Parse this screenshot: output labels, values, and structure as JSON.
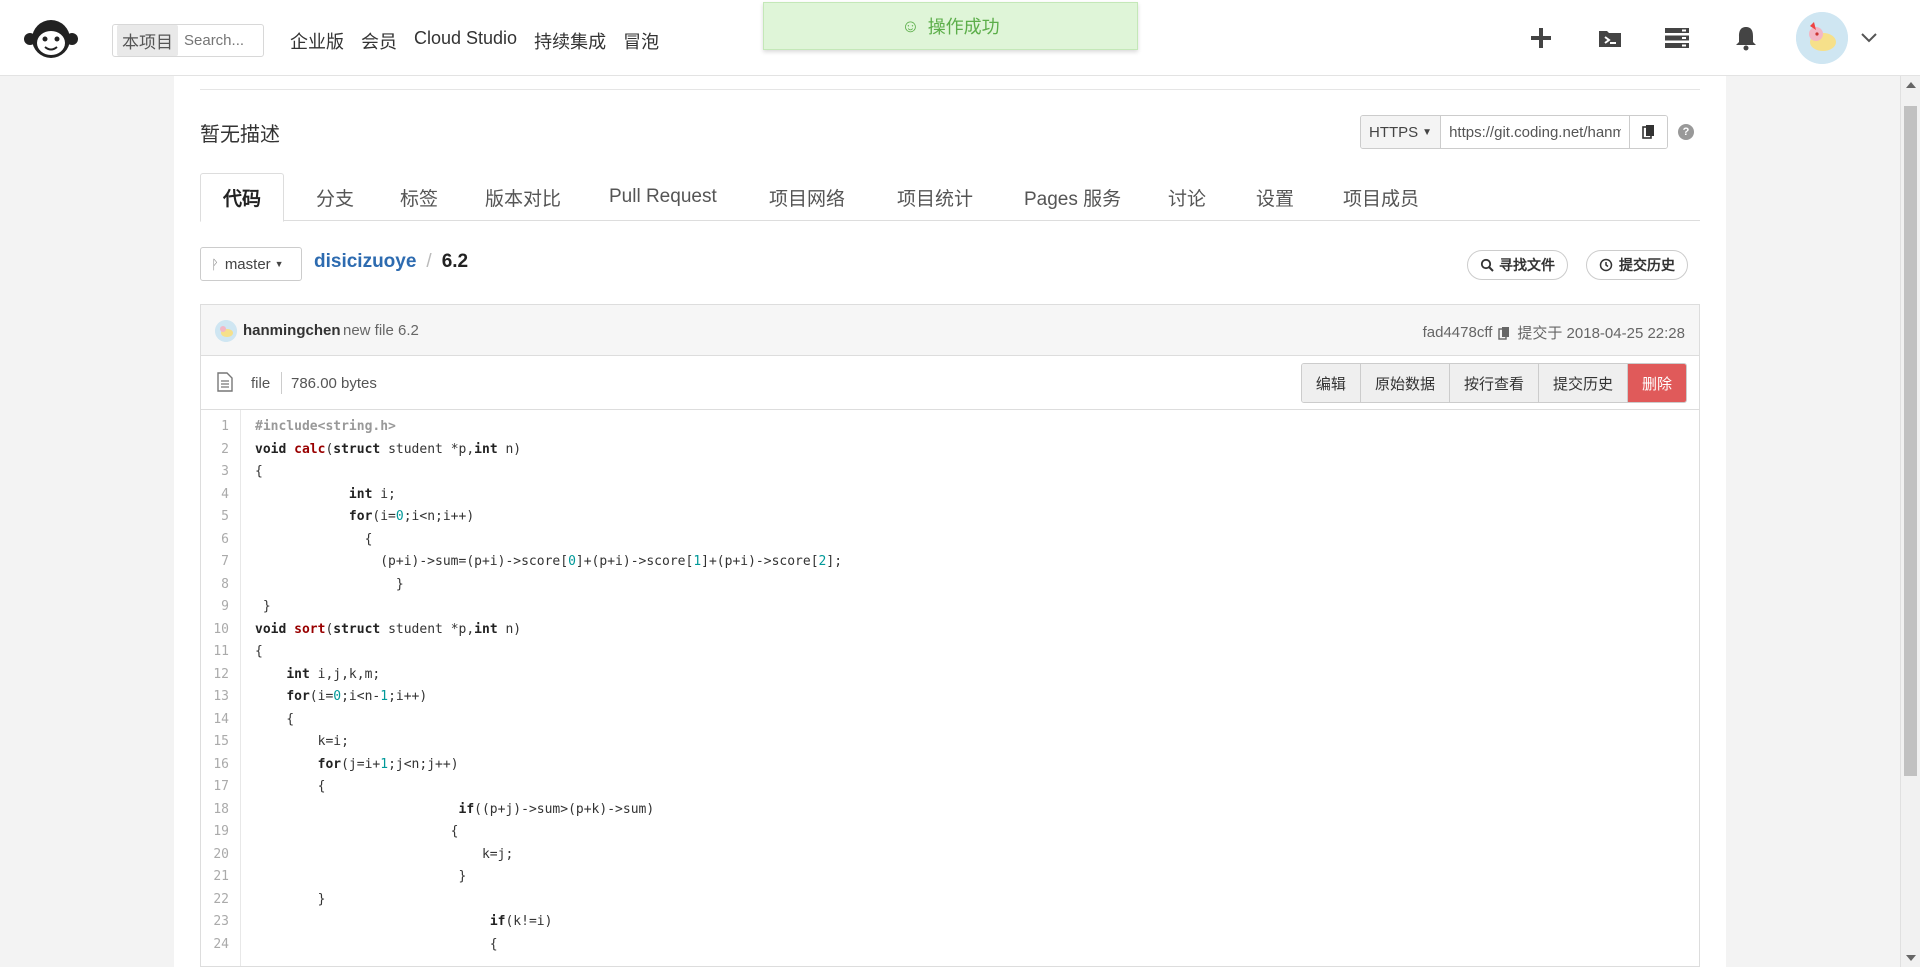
{
  "nav": {
    "scope_chip": "本项目",
    "search_placeholder": "Search...",
    "links": [
      "企业版",
      "会员",
      "Cloud Studio",
      "持续集成",
      "冒泡"
    ]
  },
  "toast": {
    "message": "操作成功"
  },
  "repo": {
    "description": "暂无描述",
    "clone_protocol": "HTTPS",
    "clone_url": "https://git.coding.net/hanmingchen/disicizuoye.git"
  },
  "tabs": [
    "代码",
    "分支",
    "标签",
    "版本对比",
    "Pull Request",
    "项目网络",
    "项目统计",
    "Pages 服务",
    "讨论",
    "设置",
    "项目成员"
  ],
  "branch": "master",
  "breadcrumb": {
    "repo": "disicizuoye",
    "separator": "/",
    "file": "6.2"
  },
  "actions": {
    "find_file": "寻找文件",
    "history": "提交历史"
  },
  "commit": {
    "user": "hanmingchen",
    "message": "new file 6.2",
    "hash": "fad4478cff",
    "time": "提交于 2018-04-25 22:28"
  },
  "file": {
    "type": "file",
    "size": "786.00 bytes",
    "buttons": [
      "编辑",
      "原始数据",
      "按行查看",
      "提交历史",
      "删除"
    ]
  },
  "code_lines": [
    "#include<string.h>",
    "void calc(struct student *p,int n)",
    "{",
    "            int i;",
    "            for(i=0;i<n;i++)",
    "              {",
    "                (p+i)->sum=(p+i)->score[0]+(p+i)->score[1]+(p+i)->score[2];",
    "                  }",
    " }",
    "void sort(struct student *p,int n)",
    "{",
    "    int i,j,k,m;",
    "    for(i=0;i<n-1;i++)",
    "    {",
    "        k=i;",
    "        for(j=i+1;j<n;j++)",
    "        {",
    "                          if((p+j)->sum>(p+k)->sum)",
    "                         {",
    "                             k=j;",
    "                          }",
    "        }",
    "                              if(k!=i)",
    "                              {"
  ],
  "colors": {
    "accent_link": "#2d6bb0",
    "danger": "#e05a5a",
    "toast_bg": "#dff5d8",
    "toast_text": "#5cae4a"
  },
  "icons": [
    "monkey-logo-icon",
    "plus-icon",
    "folder-terminal-icon",
    "server-icon",
    "bell-icon",
    "avatar",
    "chevron-down-icon",
    "copy-icon",
    "help-icon",
    "branch-icon",
    "search-icon",
    "history-icon",
    "file-icon"
  ]
}
